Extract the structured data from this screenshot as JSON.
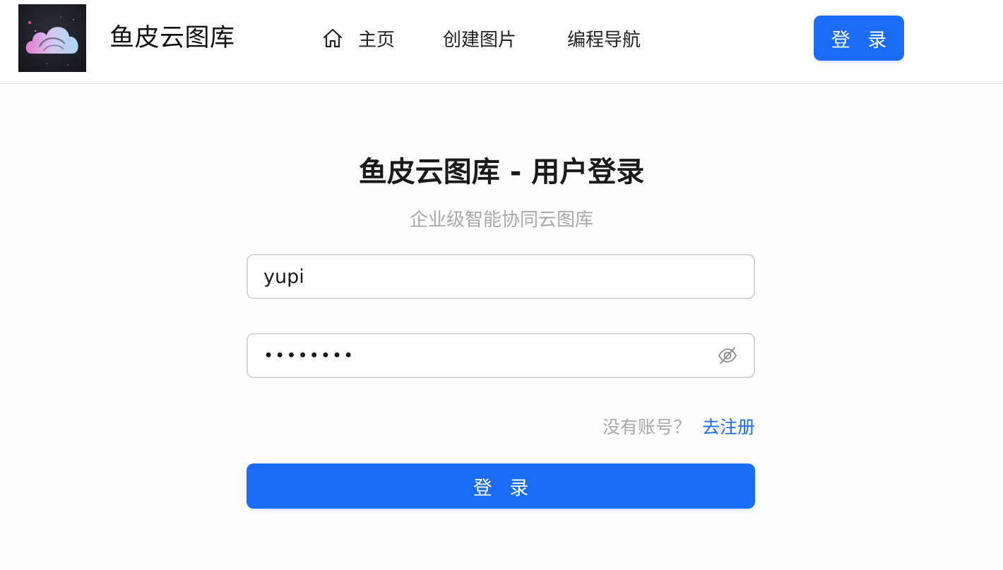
{
  "header": {
    "brand_name": "鱼皮云图库",
    "logo_icon": "cloud-logo-icon",
    "nav": [
      {
        "label": "主页",
        "icon": "home-icon",
        "active": false
      },
      {
        "label": "创建图片"
      },
      {
        "label": "编程导航"
      }
    ],
    "login_label": "登 录"
  },
  "login": {
    "title": "鱼皮云图库 - 用户登录",
    "subtitle": "企业级智能协同云图库",
    "username_value": "yupi",
    "password_value": "••••••••",
    "password_visibility_icon": "eye-off-icon",
    "register_hint": "没有账号？",
    "register_link": "去注册",
    "submit_label": "登 录"
  },
  "colors": {
    "primary": "#1a6cf6",
    "muted_text": "#a8a8a8",
    "border": "#d6d6d6"
  }
}
